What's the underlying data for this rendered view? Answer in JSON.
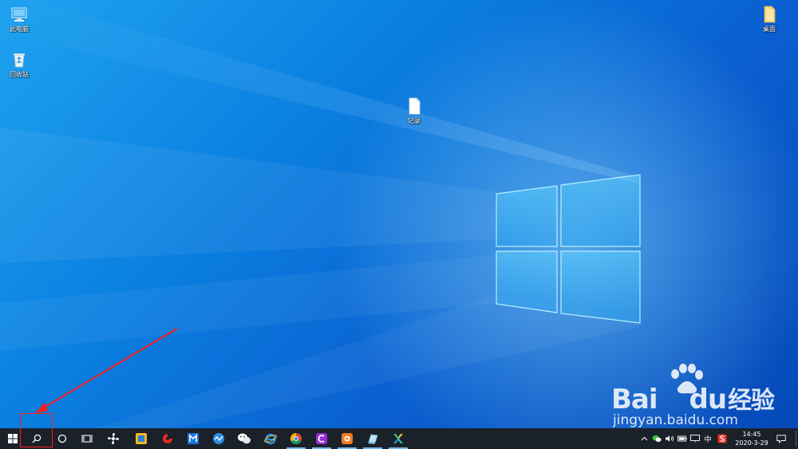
{
  "desktop": {
    "icons": [
      {
        "label": "此电脑",
        "icon": "computer-icon"
      },
      {
        "label": "回收站",
        "icon": "recycle-bin-icon"
      },
      {
        "label": "记录",
        "icon": "text-file-icon"
      },
      {
        "label": "桌面",
        "icon": "folder-icon"
      }
    ]
  },
  "taskbar": {
    "start": {
      "icon": "windows-start-icon"
    },
    "search": {
      "icon": "search-icon"
    },
    "cortana": {
      "icon": "cortana-circle-icon"
    },
    "task_view": {
      "icon": "task-view-icon"
    },
    "apps": [
      {
        "name": "fan-app-icon"
      },
      {
        "name": "yellow-box-app-icon"
      },
      {
        "name": "red-swirl-app-icon"
      },
      {
        "name": "blue-m-app-icon"
      },
      {
        "name": "network-app-icon"
      },
      {
        "name": "wechat-icon"
      },
      {
        "name": "internet-explorer-icon"
      },
      {
        "name": "chrome-icon"
      },
      {
        "name": "purple-c-app-icon"
      },
      {
        "name": "orange-app-icon"
      },
      {
        "name": "notebook-app-icon"
      },
      {
        "name": "colorful-x-app-icon"
      }
    ],
    "tray": {
      "ime_label": "中",
      "icons": [
        "chevron-up-icon",
        "wechat-tray-icon",
        "volume-icon",
        "battery-icon",
        "display-icon",
        "sogou-icon",
        "notification-icon"
      ]
    },
    "clock": {
      "time": "14:45",
      "date": "2020-3-29"
    }
  },
  "watermark": {
    "brand_prefix": "Bai",
    "brand_suffix": "du",
    "brand_cn": "经验",
    "url": "jingyan.baidu.com"
  },
  "colors": {
    "taskbar_bg": "#1b2129",
    "highlight": "#ff1a1a",
    "accent": "#76b9ed"
  }
}
